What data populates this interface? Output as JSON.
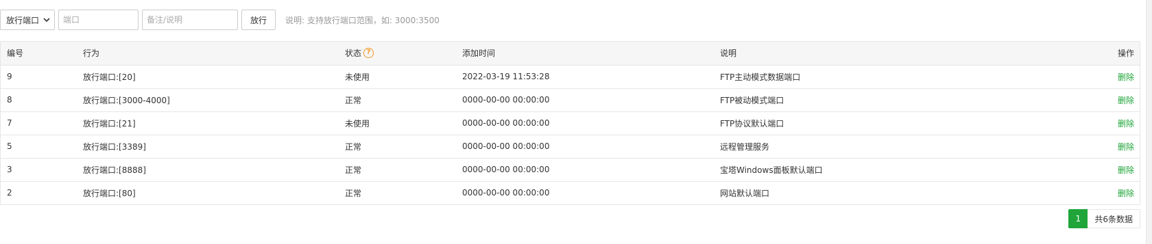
{
  "toolbar": {
    "select_value": "放行端口",
    "port_placeholder": "端口",
    "note_placeholder": "备注/说明",
    "submit_label": "放行",
    "hint": "说明: 支持放行端口范围，如: 3000:3500"
  },
  "table": {
    "headers": {
      "id": "编号",
      "action": "行为",
      "status": "状态",
      "time": "添加时间",
      "desc": "说明",
      "op": "操作"
    },
    "status_help_icon": "question-icon",
    "rows": [
      {
        "id": "9",
        "action": "放行端口:[20]",
        "status": "未使用",
        "time": "2022-03-19 11:53:28",
        "desc": "FTP主动模式数据端口",
        "op": "删除"
      },
      {
        "id": "8",
        "action": "放行端口:[3000-4000]",
        "status": "正常",
        "time": "0000-00-00 00:00:00",
        "desc": "FTP被动模式端口",
        "op": "删除"
      },
      {
        "id": "7",
        "action": "放行端口:[21]",
        "status": "未使用",
        "time": "0000-00-00 00:00:00",
        "desc": "FTP协议默认端口",
        "op": "删除"
      },
      {
        "id": "5",
        "action": "放行端口:[3389]",
        "status": "正常",
        "time": "0000-00-00 00:00:00",
        "desc": "远程管理服务",
        "op": "删除"
      },
      {
        "id": "3",
        "action": "放行端口:[8888]",
        "status": "正常",
        "time": "0000-00-00 00:00:00",
        "desc": "宝塔Windows面板默认端口",
        "op": "删除"
      },
      {
        "id": "2",
        "action": "放行端口:[80]",
        "status": "正常",
        "time": "0000-00-00 00:00:00",
        "desc": "网站默认端口",
        "op": "删除"
      }
    ]
  },
  "pager": {
    "current": "1",
    "total_text": "共6条数据"
  },
  "colors": {
    "accent": "#20a53a",
    "help": "#f0961c",
    "header_bg": "#f6f6f6",
    "border": "#e6e6e6"
  }
}
